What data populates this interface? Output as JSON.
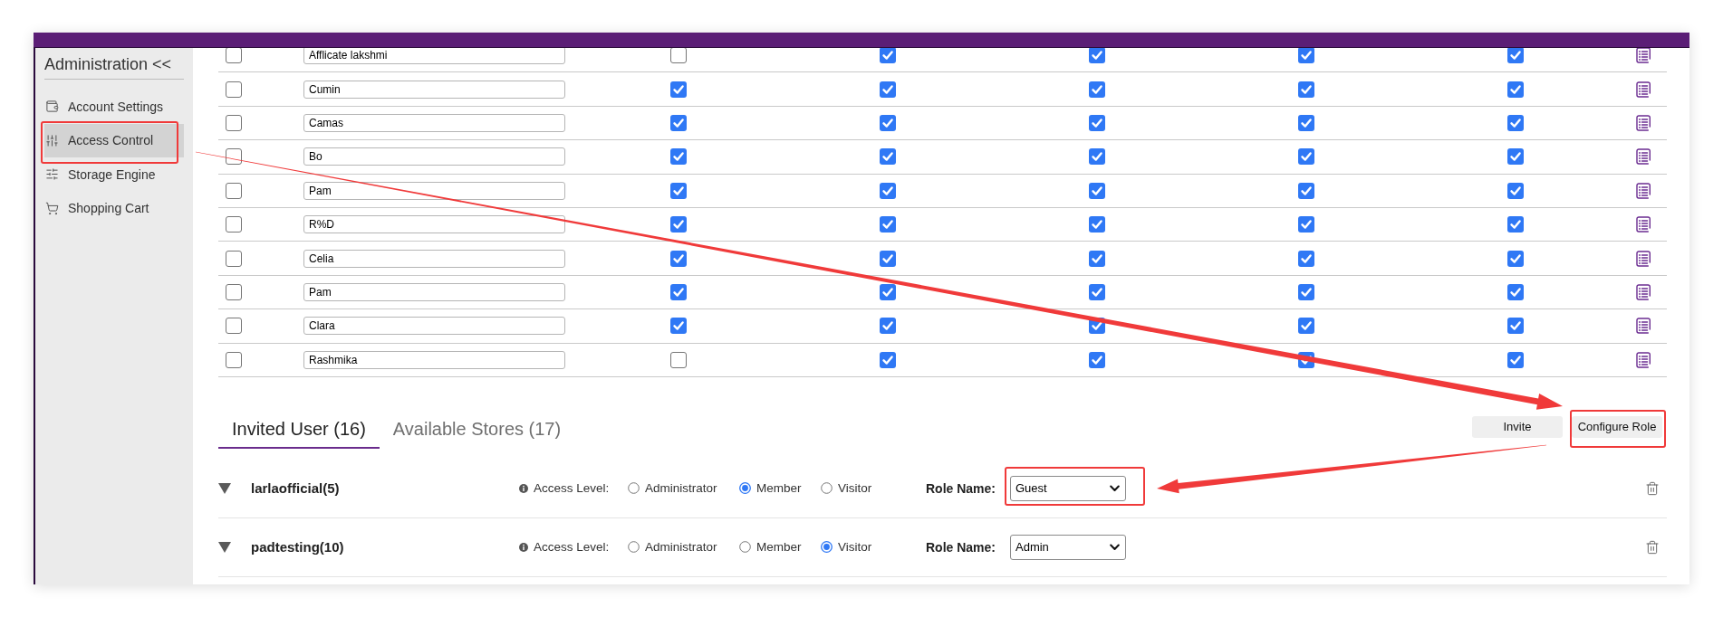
{
  "sidebar": {
    "title": "Administration <<",
    "items": [
      {
        "label": "Account Settings",
        "selected": false,
        "highlighted": false
      },
      {
        "label": "Access Control",
        "selected": true,
        "highlighted": true
      },
      {
        "label": "Storage Engine",
        "selected": false,
        "highlighted": false
      },
      {
        "label": "Shopping Cart",
        "selected": false,
        "highlighted": false
      }
    ]
  },
  "table": {
    "rows": [
      {
        "name": "Afflicate lakshmi",
        "checks": [
          {
            "checked": false
          },
          {
            "checked": false
          },
          {
            "checked": true
          },
          {
            "checked": true
          },
          {
            "checked": true
          },
          {
            "checked": true
          }
        ]
      },
      {
        "name": "Cumin",
        "checks": [
          {
            "checked": false
          },
          {
            "checked": true
          },
          {
            "checked": true
          },
          {
            "checked": true
          },
          {
            "checked": true
          },
          {
            "checked": true
          }
        ]
      },
      {
        "name": "Camas",
        "checks": [
          {
            "checked": false
          },
          {
            "checked": true
          },
          {
            "checked": true
          },
          {
            "checked": true
          },
          {
            "checked": true
          },
          {
            "checked": true
          }
        ]
      },
      {
        "name": "Bo",
        "checks": [
          {
            "checked": false
          },
          {
            "checked": true
          },
          {
            "checked": true
          },
          {
            "checked": true
          },
          {
            "checked": true
          },
          {
            "checked": true
          }
        ]
      },
      {
        "name": "Pam",
        "checks": [
          {
            "checked": false
          },
          {
            "checked": true
          },
          {
            "checked": true
          },
          {
            "checked": true
          },
          {
            "checked": true
          },
          {
            "checked": true
          }
        ]
      },
      {
        "name": "R%D",
        "checks": [
          {
            "checked": false
          },
          {
            "checked": true
          },
          {
            "checked": true
          },
          {
            "checked": true
          },
          {
            "checked": true
          },
          {
            "checked": true
          }
        ]
      },
      {
        "name": "Celia",
        "checks": [
          {
            "checked": false
          },
          {
            "checked": true
          },
          {
            "checked": true
          },
          {
            "checked": true
          },
          {
            "checked": true
          },
          {
            "checked": true
          }
        ]
      },
      {
        "name": "Pam",
        "checks": [
          {
            "checked": false
          },
          {
            "checked": true
          },
          {
            "checked": true
          },
          {
            "checked": true
          },
          {
            "checked": true
          },
          {
            "checked": true
          }
        ]
      },
      {
        "name": "Clara",
        "checks": [
          {
            "checked": false
          },
          {
            "checked": true
          },
          {
            "checked": true
          },
          {
            "checked": true
          },
          {
            "checked": true
          },
          {
            "checked": true
          }
        ]
      },
      {
        "name": "Rashmika",
        "checks": [
          {
            "checked": false
          },
          {
            "checked": false
          },
          {
            "checked": true
          },
          {
            "checked": true
          },
          {
            "checked": true
          },
          {
            "checked": true
          }
        ]
      }
    ]
  },
  "tabs": [
    {
      "label": "Invited User (16)",
      "selected": true
    },
    {
      "label": "Available Stores (17)",
      "selected": false
    }
  ],
  "buttons": [
    {
      "label": "Invite",
      "highlighted": false
    },
    {
      "label": "Configure Role",
      "highlighted": true
    }
  ],
  "users": [
    {
      "name": "larlaofficial(5)",
      "access_label": "Access Level:",
      "access_options": [
        {
          "label": "Administrator",
          "selected": false
        },
        {
          "label": "Member",
          "selected": true
        },
        {
          "label": "Visitor",
          "selected": false
        }
      ],
      "role_label": "Role Name:",
      "role": {
        "value": "Guest",
        "highlighted": true
      }
    },
    {
      "name": "padtesting(10)",
      "access_label": "Access Level:",
      "access_options": [
        {
          "label": "Administrator",
          "selected": false
        },
        {
          "label": "Member",
          "selected": false
        },
        {
          "label": "Visitor",
          "selected": true
        }
      ],
      "role_label": "Role Name:",
      "role": {
        "value": "Admin",
        "highlighted": false
      }
    }
  ]
}
